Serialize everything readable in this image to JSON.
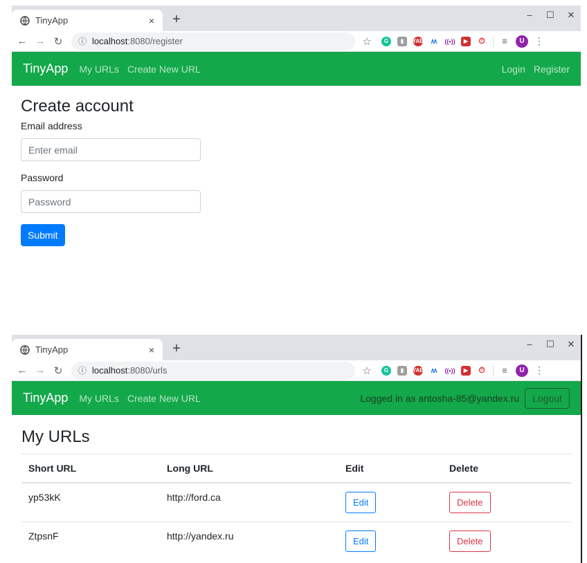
{
  "colors": {
    "navbar": "#13a84a",
    "primary": "#007bff",
    "danger": "#dc3545",
    "avatar": "#8e24aa"
  },
  "window1": {
    "tab_title": "TinyApp",
    "url_host": "localhost",
    "url_path": ":8080/register",
    "nav": {
      "brand": "TinyApp",
      "my_urls": "My URLs",
      "create_new": "Create New URL",
      "login": "Login",
      "register": "Register"
    },
    "form": {
      "heading": "Create account",
      "email_label": "Email address",
      "email_placeholder": "Enter email",
      "password_label": "Password",
      "password_placeholder": "Password",
      "submit": "Submit"
    }
  },
  "window2": {
    "tab_title": "TinyApp",
    "url_host": "localhost",
    "url_path": ":8080/urls",
    "nav": {
      "brand": "TinyApp",
      "my_urls": "My URLs",
      "create_new": "Create New URL",
      "logged_in": "Logged in as antosha-85@yandex.ru",
      "logout": "Logout"
    },
    "heading": "My URLs",
    "table": {
      "headers": [
        "Short URL",
        "Long URL",
        "Edit",
        "Delete"
      ],
      "rows": [
        {
          "short": "yp53kK",
          "long": "http://ford.ca",
          "edit": "Edit",
          "delete": "Delete"
        },
        {
          "short": "ZtpsnF",
          "long": "http://yandex.ru",
          "edit": "Edit",
          "delete": "Delete"
        }
      ]
    }
  },
  "browser": {
    "new_tab": "+",
    "close": "×",
    "avatar_letter": "U",
    "icons": [
      "globe-icon",
      "back-icon",
      "forward-icon",
      "reload-icon",
      "info-icon",
      "star-icon",
      "grammarly-icon",
      "extension-icon",
      "yab-icon",
      "music-icon",
      "broadcast-icon",
      "youtube-icon",
      "timer-icon",
      "reading-list-icon",
      "kebab-menu-icon"
    ]
  }
}
